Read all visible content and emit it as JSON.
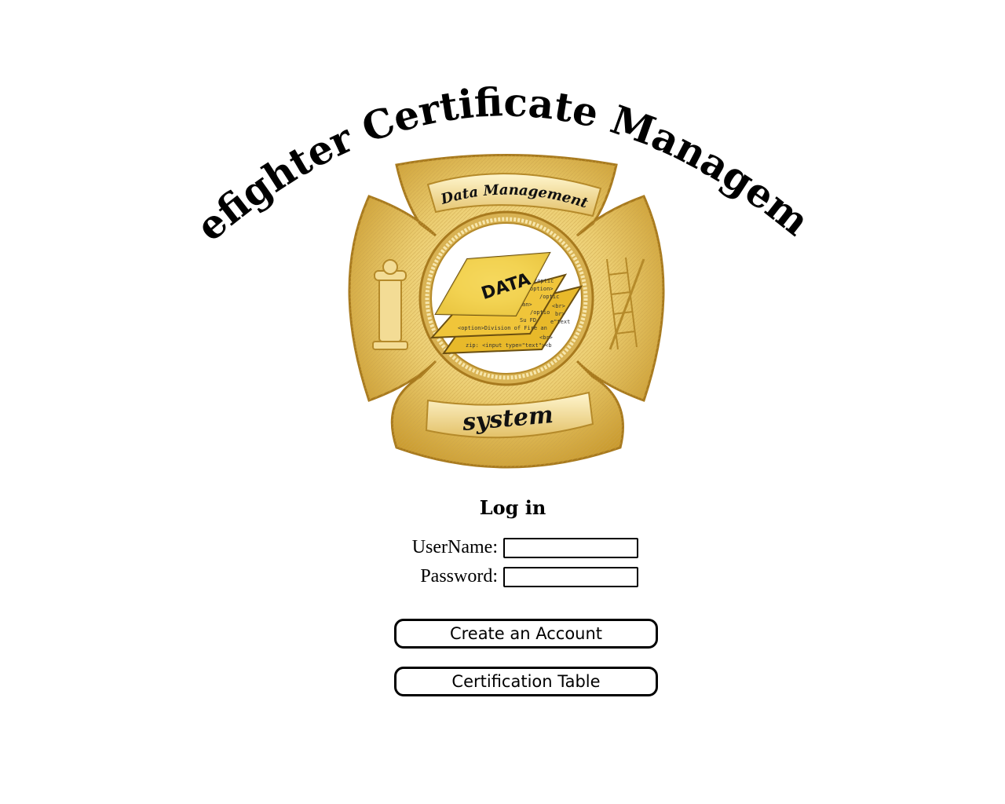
{
  "header": {
    "title": "Firefighter Certificate Management"
  },
  "badge": {
    "top_banner": "Data Management",
    "center_word": "DATA",
    "bottom_banner": "system",
    "code_lines": [
      "/optic",
      "option>",
      "/optic",
      "an>",
      "<br>",
      "/optio",
      "br>",
      "Su FD",
      "e\"text",
      "<option>Division of Fire an",
      "<br>",
      "zip: <input type=\"text\"><b"
    ],
    "metal_color": "#e9c96a",
    "paper_color": "#f4d34a"
  },
  "login": {
    "heading": "Log in",
    "username_label": "UserName:",
    "username_value": "",
    "password_label": "Password:",
    "password_value": ""
  },
  "actions": {
    "create_account_label": "Create an Account",
    "certification_table_label": "Certification Table"
  }
}
